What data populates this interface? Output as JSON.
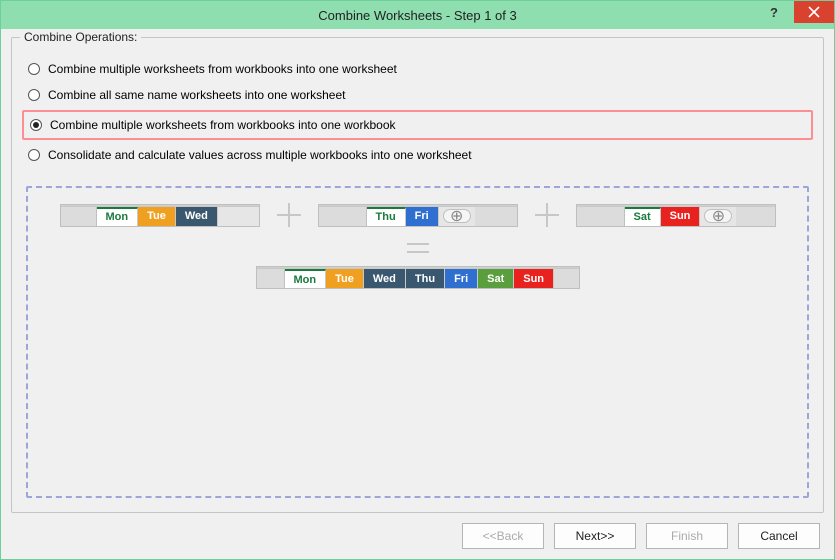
{
  "window": {
    "title": "Combine Worksheets - Step 1 of 3"
  },
  "group": {
    "legend": "Combine Operations:"
  },
  "options": [
    {
      "label": "Combine multiple worksheets from workbooks into one worksheet",
      "selected": false
    },
    {
      "label": "Combine all same name worksheets into one worksheet",
      "selected": false
    },
    {
      "label": "Combine multiple worksheets from workbooks into one workbook",
      "selected": true
    },
    {
      "label": "Consolidate and calculate values across multiple workbooks into one worksheet",
      "selected": false
    }
  ],
  "preview": {
    "wb1": {
      "tabs": [
        "Mon",
        "Tue",
        "Wed"
      ]
    },
    "wb2": {
      "tabs": [
        "Thu",
        "Fri"
      ]
    },
    "wb3": {
      "tabs": [
        "Sat",
        "Sun"
      ]
    },
    "result": {
      "tabs": [
        "Mon",
        "Tue",
        "Wed",
        "Thu",
        "Fri",
        "Sat",
        "Sun"
      ]
    },
    "plus_symbol": "⊕"
  },
  "buttons": {
    "back": "<<Back",
    "next": "Next>>",
    "finish": "Finish",
    "cancel": "Cancel"
  }
}
